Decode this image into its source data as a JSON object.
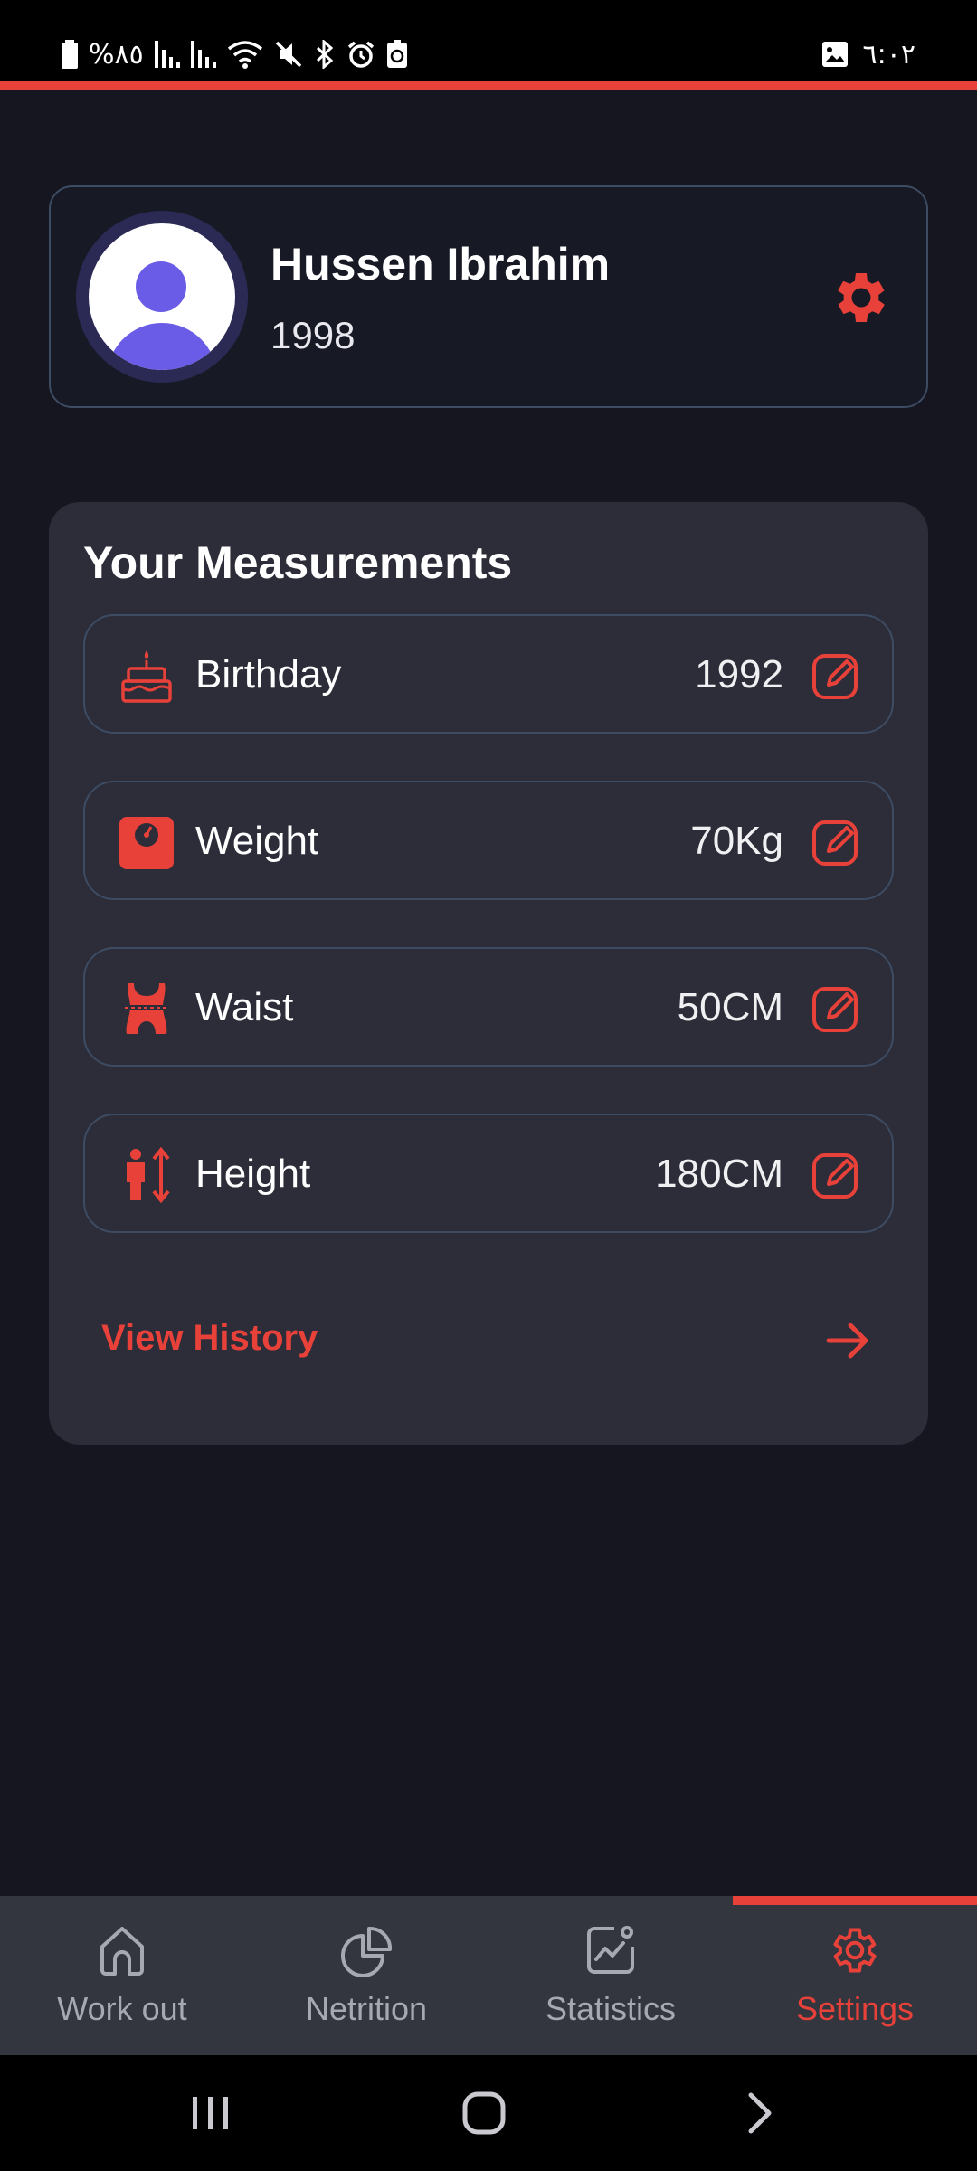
{
  "status_bar": {
    "battery_text": "%٨٥",
    "time": "٦:٠٢"
  },
  "profile": {
    "name": "Hussen Ibrahim",
    "year": "1998"
  },
  "measurements": {
    "title": "Your Measurements",
    "items": [
      {
        "label": "Birthday",
        "value": "1992",
        "icon": "cake-icon"
      },
      {
        "label": "Weight",
        "value": "70Kg",
        "icon": "scale-icon"
      },
      {
        "label": "Waist",
        "value": "50CM",
        "icon": "waist-icon"
      },
      {
        "label": "Height",
        "value": "180CM",
        "icon": "height-icon"
      }
    ],
    "view_history": "View History"
  },
  "nav": {
    "items": [
      {
        "label": "Work out",
        "icon": "home-icon"
      },
      {
        "label": "Netrition",
        "icon": "pie-chart-icon"
      },
      {
        "label": "Statistics",
        "icon": "chart-icon"
      },
      {
        "label": "Settings",
        "icon": "gear-icon"
      }
    ],
    "active_index": 3
  },
  "colors": {
    "accent": "#e8413a",
    "background": "#161620",
    "panel": "#2c2d39",
    "border": "#3d4c63",
    "avatar": "#6b5ce7"
  }
}
